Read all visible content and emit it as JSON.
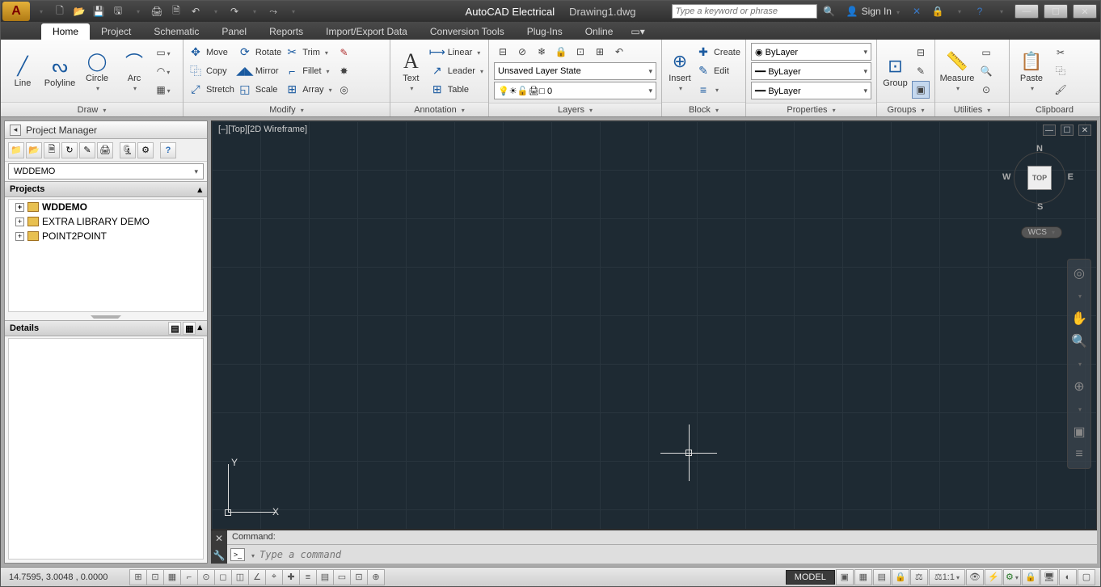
{
  "title": {
    "app": "AutoCAD Electrical",
    "doc": "Drawing1.dwg"
  },
  "qat_icons": [
    "new",
    "open",
    "save",
    "saveas",
    "|",
    "plot",
    "preview",
    "|",
    "undo",
    "redo",
    "|",
    "workspace"
  ],
  "search": {
    "placeholder": "Type a keyword or phrase"
  },
  "signin": {
    "label": "Sign In"
  },
  "tabs": [
    "Home",
    "Project",
    "Schematic",
    "Panel",
    "Reports",
    "Import/Export Data",
    "Conversion Tools",
    "Plug-Ins",
    "Online"
  ],
  "active_tab": "Home",
  "ribbon": {
    "draw": {
      "label": "Draw",
      "items": [
        "Line",
        "Polyline",
        "Circle",
        "Arc"
      ]
    },
    "modify": {
      "label": "Modify",
      "col1": [
        "Move",
        "Copy",
        "Stretch"
      ],
      "col2": [
        "Rotate",
        "Mirror",
        "Scale"
      ],
      "col3": [
        "Trim",
        "Fillet",
        "Array"
      ]
    },
    "annotation": {
      "label": "Annotation",
      "big": "Text",
      "items": [
        "Linear",
        "Leader",
        "Table"
      ]
    },
    "layers": {
      "label": "Layers",
      "state": "Unsaved Layer State",
      "current": "0"
    },
    "block": {
      "label": "Block",
      "big": "Insert",
      "items": [
        "Create",
        "Edit",
        ""
      ]
    },
    "properties": {
      "label": "Properties",
      "color": "ByLayer",
      "ltype": "ByLayer",
      "lweight": "ByLayer"
    },
    "groups": {
      "label": "Groups",
      "big": "Group"
    },
    "utilities": {
      "label": "Utilities",
      "big": "Measure"
    },
    "clipboard": {
      "label": "Clipboard",
      "big": "Paste"
    }
  },
  "project_manager": {
    "title": "Project Manager",
    "current": "WDDEMO",
    "section_projects": "Projects",
    "section_details": "Details",
    "tree": [
      {
        "name": "WDDEMO",
        "bold": true
      },
      {
        "name": "EXTRA LIBRARY DEMO",
        "bold": false
      },
      {
        "name": "POINT2POINT",
        "bold": false
      }
    ]
  },
  "canvas": {
    "view_label": "[–][Top][2D Wireframe]",
    "cube_face": "TOP",
    "dirs": {
      "n": "N",
      "e": "E",
      "s": "S",
      "w": "W"
    },
    "wcs": "WCS",
    "ucs": {
      "x": "X",
      "y": "Y"
    }
  },
  "command": {
    "history": "Command:",
    "placeholder": "Type a command"
  },
  "status": {
    "coords": "14.7595, 3.0048 , 0.0000",
    "model": "MODEL",
    "scale": "1:1"
  }
}
